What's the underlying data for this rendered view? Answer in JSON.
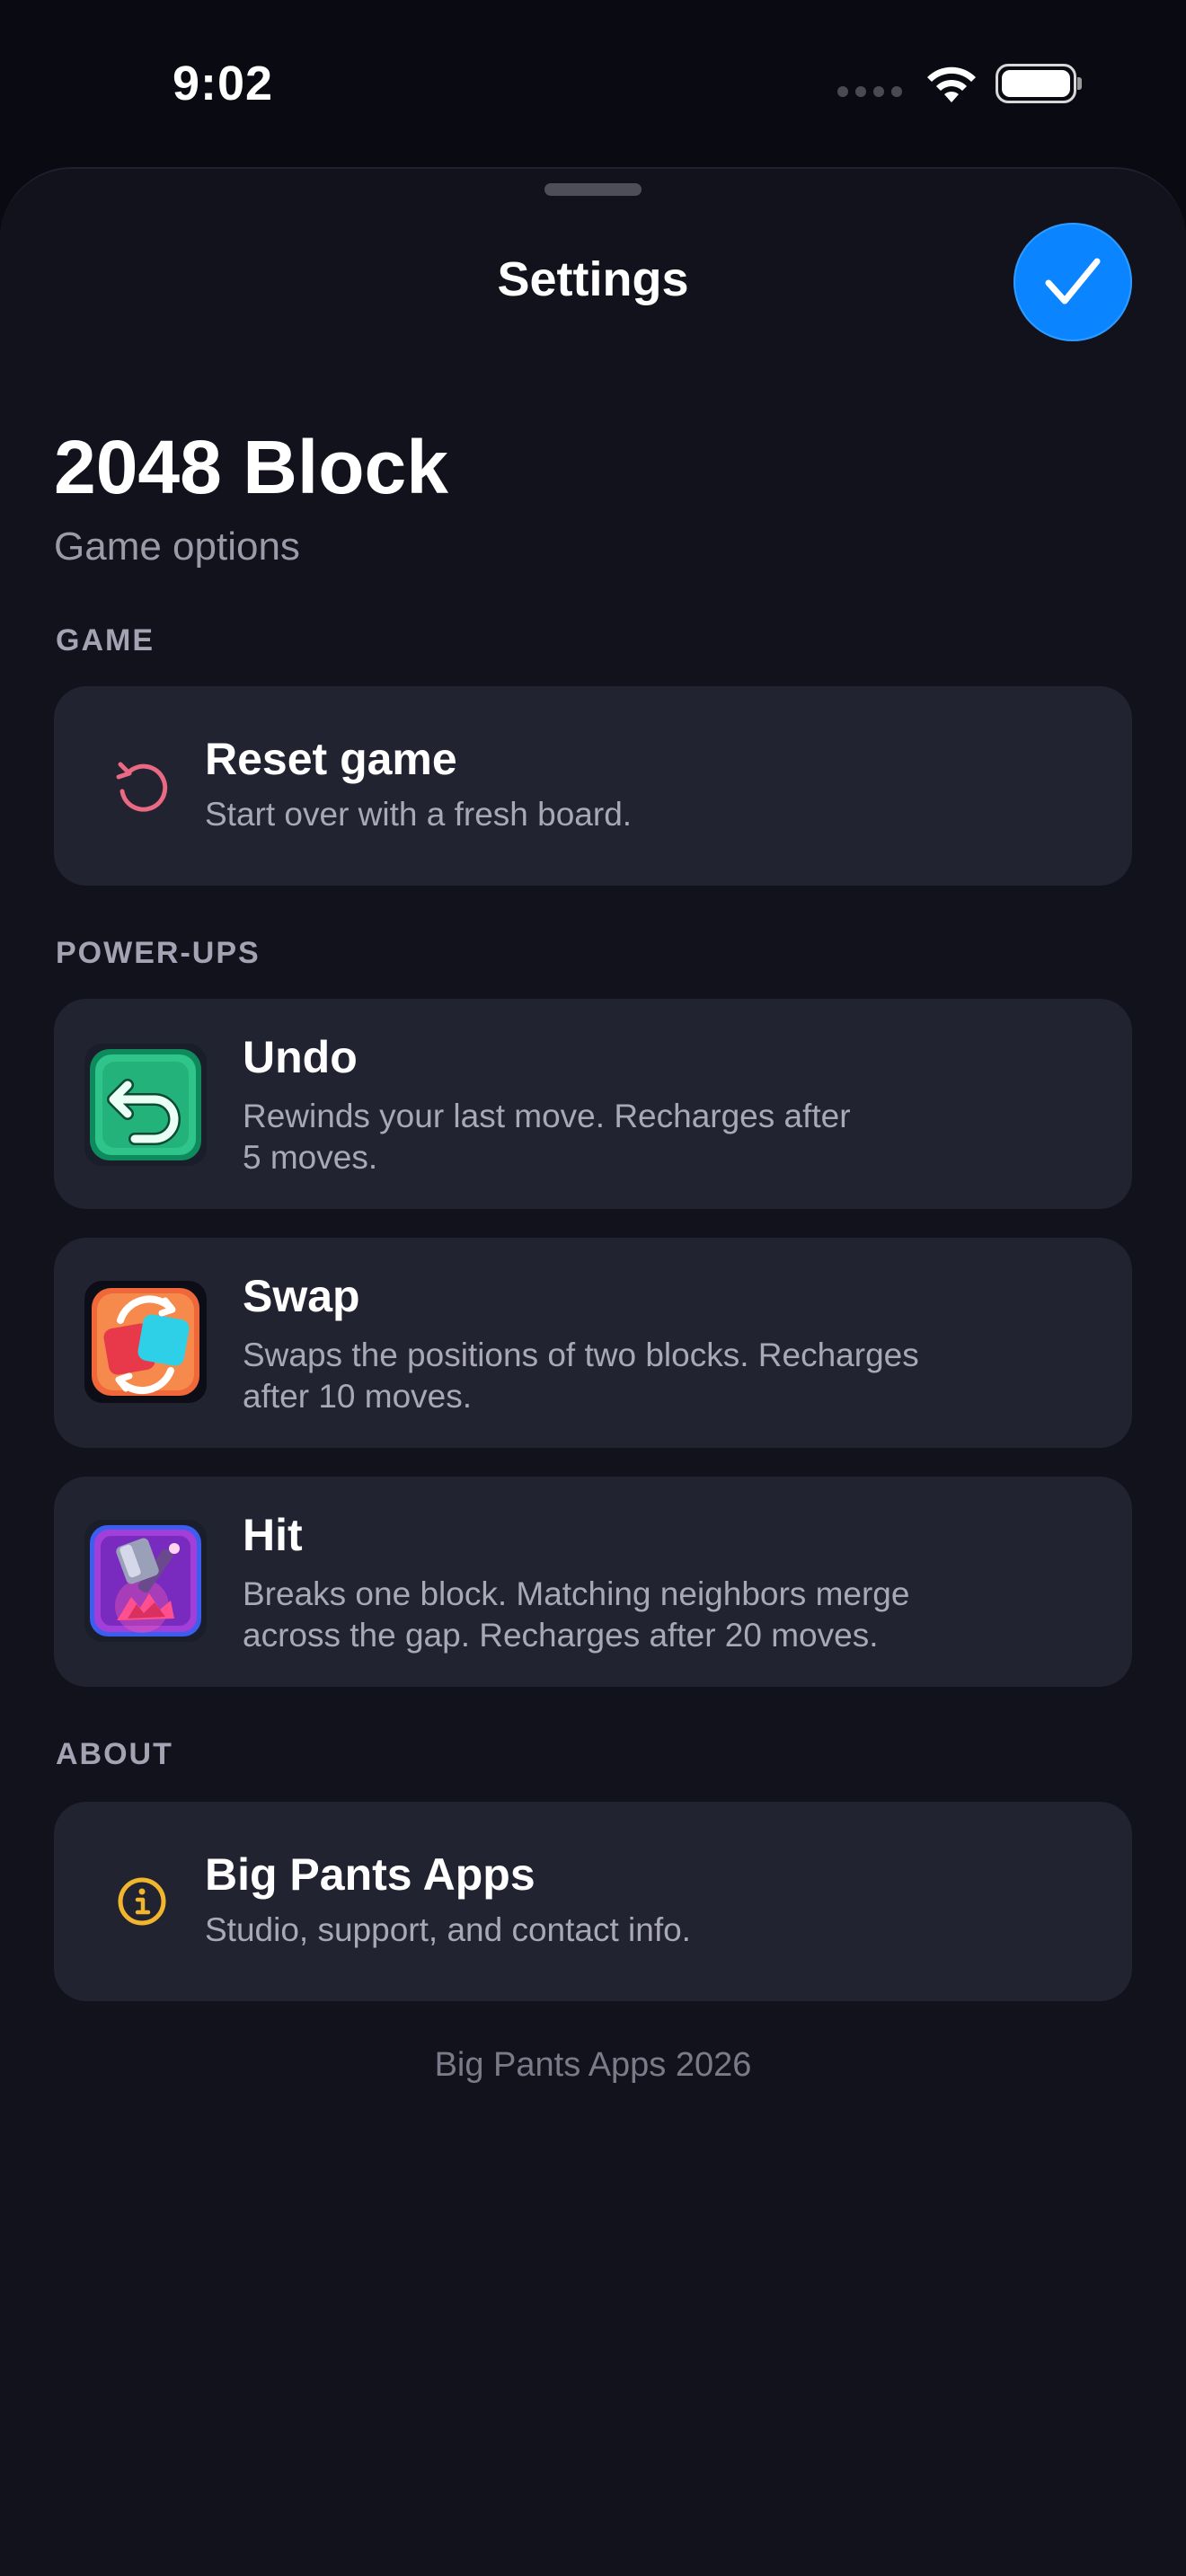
{
  "status_bar": {
    "time": "9:02"
  },
  "sheet": {
    "title": "Settings",
    "done_icon": "checkmark-icon",
    "accent": "#0a84ff"
  },
  "header": {
    "title": "2048 Block",
    "subtitle": "Game options"
  },
  "sections": {
    "game": {
      "label": "GAME",
      "reset": {
        "title": "Reset game",
        "description": "Start over with a fresh board.",
        "icon": "reset-icon",
        "icon_color": "#e96a82"
      }
    },
    "powerups": {
      "label": "POWER-UPS",
      "items": [
        {
          "title": "Undo",
          "line1": "Rewinds your last move. Recharges after",
          "line2": "5 moves.",
          "icon": "undo-powerup-icon"
        },
        {
          "title": "Swap",
          "line1": "Swaps the positions of two blocks. Recharges",
          "line2": "after 10 moves.",
          "icon": "swap-powerup-icon"
        },
        {
          "title": "Hit",
          "line1": "Breaks one block. Matching neighbors merge",
          "line2": "across the gap. Recharges after 20 moves.",
          "icon": "hammer-powerup-icon"
        }
      ]
    },
    "about": {
      "label": "ABOUT",
      "studio": {
        "title": "Big Pants Apps",
        "description": "Studio, support, and contact info.",
        "icon": "info-icon",
        "icon_color": "#f2b52e"
      }
    }
  },
  "footer": {
    "text": "Big Pants Apps 2026"
  }
}
